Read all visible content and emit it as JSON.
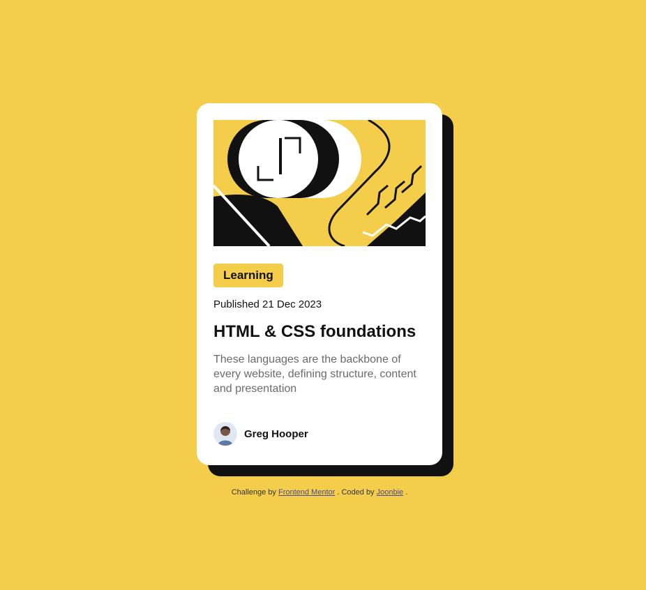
{
  "card": {
    "category": "Learning",
    "published": "Published 21 Dec 2023",
    "title": "HTML & CSS foundations",
    "description": "These languages are the backbone of every website, defining structure, content and presentation",
    "author_name": "Greg Hooper"
  },
  "attribution": {
    "prefix": "Challenge by ",
    "link1": "Frontend Mentor",
    "middle": ". Coded by ",
    "link2": "Joonbie",
    "suffix": "."
  },
  "colors": {
    "background": "#f4ce4a",
    "card": "#ffffff",
    "shadow": "#111111",
    "text": "#111111",
    "muted": "#6b6b6b"
  },
  "icons": {
    "avatar": "avatar-icon",
    "illustration": "abstract-illustration"
  }
}
